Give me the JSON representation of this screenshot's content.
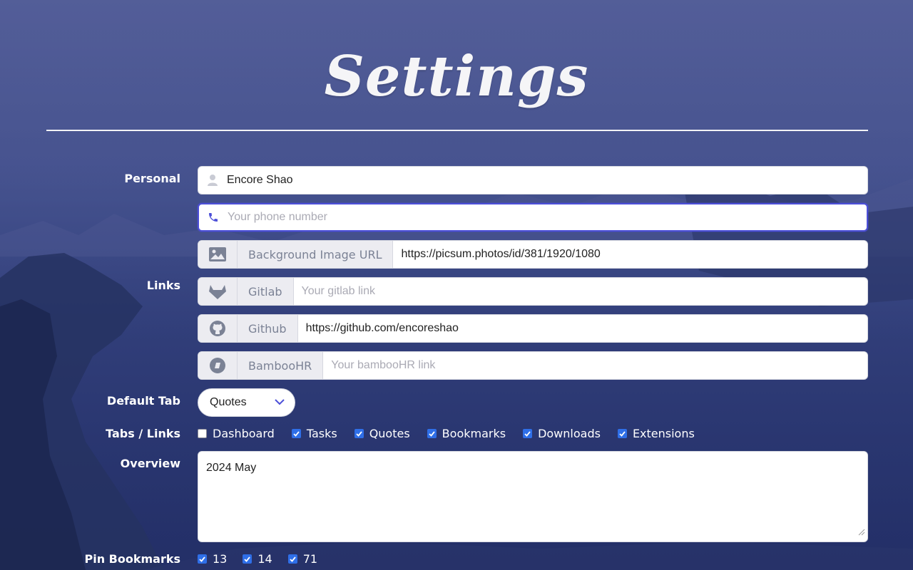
{
  "page": {
    "title": "Settings"
  },
  "labels": {
    "personal": "Personal",
    "links": "Links",
    "default_tab": "Default Tab",
    "tabs_links": "Tabs / Links",
    "overview": "Overview",
    "pin_bookmarks": "Pin Bookmarks"
  },
  "personal": {
    "name": {
      "value": "Encore Shao",
      "icon": "user-icon"
    },
    "phone": {
      "value": "",
      "placeholder": "Your phone number",
      "icon": "phone-icon"
    },
    "background": {
      "label": "Background Image URL",
      "value": "https://picsum.photos/id/381/1920/1080",
      "icon": "image-icon"
    }
  },
  "links": {
    "gitlab": {
      "label": "Gitlab",
      "value": "",
      "placeholder": "Your gitlab link",
      "icon": "gitlab-icon"
    },
    "github": {
      "label": "Github",
      "value": "https://github.com/encoreshao",
      "placeholder": "",
      "icon": "github-icon"
    },
    "bamboohr": {
      "label": "BambooHR",
      "value": "",
      "placeholder": "Your bambooHR link",
      "icon": "bamboohr-icon"
    }
  },
  "default_tab": {
    "selected": "Quotes"
  },
  "tabs": [
    {
      "label": "Dashboard",
      "checked": false
    },
    {
      "label": "Tasks",
      "checked": true
    },
    {
      "label": "Quotes",
      "checked": true
    },
    {
      "label": "Bookmarks",
      "checked": true
    },
    {
      "label": "Downloads",
      "checked": true
    },
    {
      "label": "Extensions",
      "checked": true
    }
  ],
  "overview": {
    "value": "2024 May"
  },
  "pin_bookmarks": [
    {
      "label": "13",
      "checked": true
    },
    {
      "label": "14",
      "checked": true
    },
    {
      "label": "71",
      "checked": true
    }
  ],
  "colors": {
    "accent": "#4c4fd8",
    "checkbox": "#2f6fe8",
    "addon_bg": "#ececf1"
  }
}
